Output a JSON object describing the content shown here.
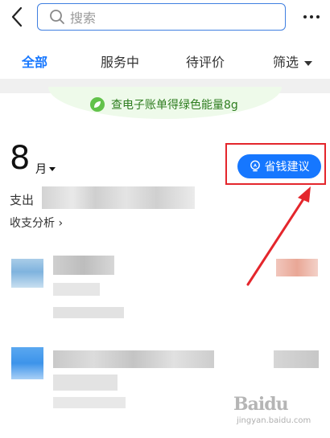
{
  "header": {
    "back_icon": "chevron-left-icon",
    "search_icon": "search-icon",
    "search_placeholder": "搜索",
    "more_icon": "more-dots-icon"
  },
  "tabs": [
    {
      "label": "全部",
      "active": true
    },
    {
      "label": "服务中",
      "active": false
    },
    {
      "label": "待评价",
      "active": false
    },
    {
      "label": "筛选",
      "active": false
    }
  ],
  "banner": {
    "text": "查电子账单得绿色能量8g",
    "badge_color": "#62c24a",
    "text_color": "#2e7d1f"
  },
  "summary": {
    "month": "8",
    "month_unit": "月",
    "savings_button": "省钱建议",
    "expense_label": "支出",
    "analysis_link": "收支分析 ›"
  },
  "watermark": {
    "text": "Baidu",
    "sub": "jingyan.baidu.com"
  },
  "colors": {
    "accent": "#1677ff",
    "highlight": "#e4262c"
  }
}
